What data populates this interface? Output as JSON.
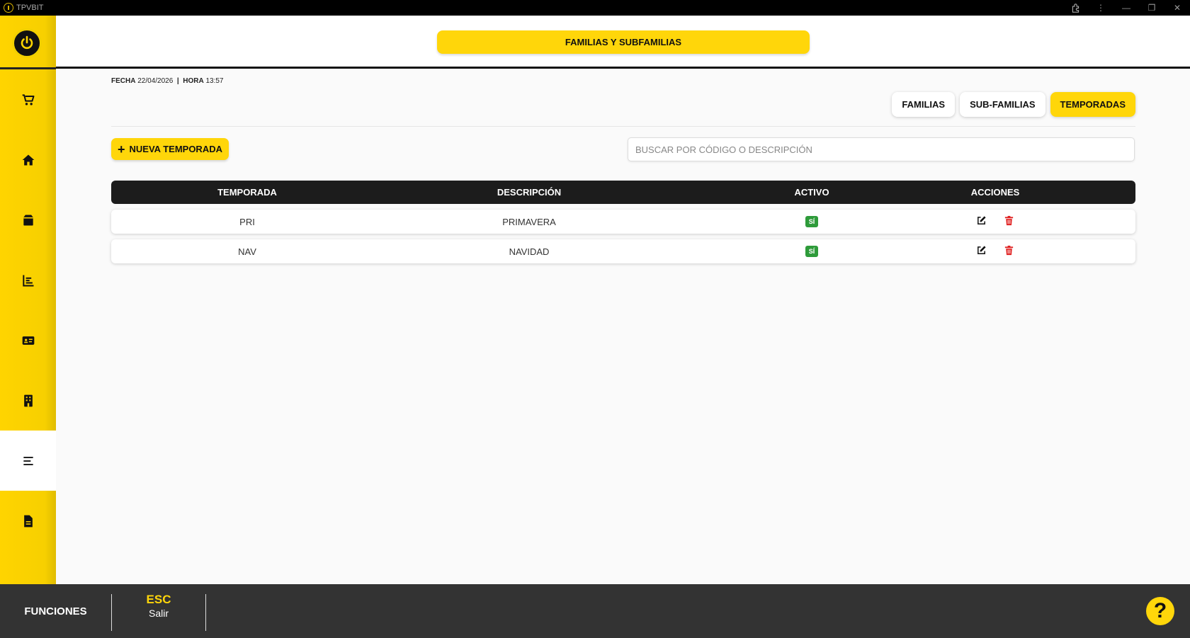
{
  "window": {
    "title": "TPVBIT"
  },
  "header": {
    "title": "FAMILIAS Y SUBFAMILIAS"
  },
  "datetime": {
    "fecha_label": "FECHA",
    "fecha": "22/04/2026",
    "separator": "|",
    "hora_label": "HORA",
    "hora": "13:57"
  },
  "tabs": [
    {
      "label": "FAMILIAS",
      "active": false
    },
    {
      "label": "SUB-FAMILIAS",
      "active": false
    },
    {
      "label": "TEMPORADAS",
      "active": true
    }
  ],
  "actions": {
    "new_label": "NUEVA TEMPORADA",
    "plus": "+"
  },
  "search": {
    "placeholder": "BUSCAR POR CÓDIGO O DESCRIPCIÓN",
    "value": ""
  },
  "table": {
    "headers": [
      "TEMPORADA",
      "DESCRIPCIÓN",
      "ACTIVO",
      "ACCIONES"
    ],
    "rows": [
      {
        "temporada": "PRI",
        "descripcion": "PRIMAVERA",
        "activo": "SÍ"
      },
      {
        "temporada": "NAV",
        "descripcion": "NAVIDAD",
        "activo": "SÍ"
      }
    ]
  },
  "sidebar": {
    "items": [
      {
        "icon": "cart-icon"
      },
      {
        "icon": "home-icon"
      },
      {
        "icon": "box-icon"
      },
      {
        "icon": "chart-icon"
      },
      {
        "icon": "id-card-icon"
      },
      {
        "icon": "building-icon"
      },
      {
        "icon": "menu-icon",
        "active": true
      },
      {
        "icon": "document-icon"
      }
    ]
  },
  "footer": {
    "functions_label": "FUNCIONES",
    "key": "ESC",
    "key_label": "Salir",
    "help": "?"
  },
  "colors": {
    "accent": "#ffd60a",
    "dark": "#1c1c1c",
    "active_badge": "#2e9b3a",
    "delete": "#e02020"
  }
}
